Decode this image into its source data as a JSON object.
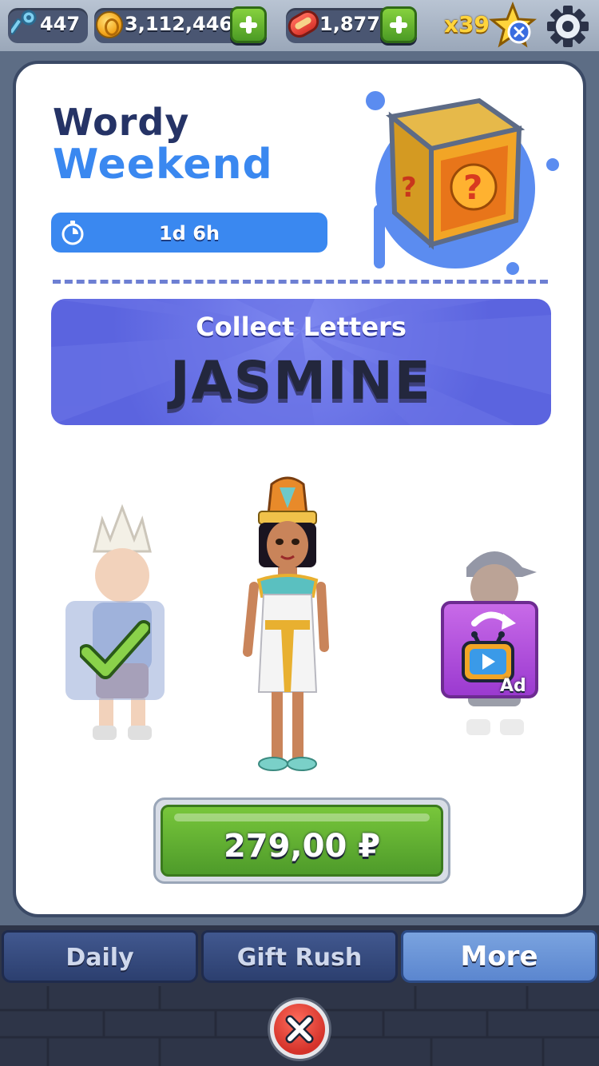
{
  "topbar": {
    "keys": "447",
    "coins": "3,112,446",
    "boards": "1,877",
    "multiplier": "x39"
  },
  "event": {
    "title_line1": "Wordy",
    "title_line2": "Weekend",
    "timer": "1d 6h"
  },
  "collect": {
    "label": "Collect Letters",
    "word": "JASMINE"
  },
  "purchase": {
    "price": "279,00 ₽"
  },
  "ad_badge": "Ad",
  "tabs": [
    {
      "label": "Daily",
      "active": false
    },
    {
      "label": "Gift Rush",
      "active": false
    },
    {
      "label": "More",
      "active": true
    }
  ],
  "colors": {
    "accent_blue": "#3a88f0",
    "title_navy": "#253366",
    "panel_purple": "#5b64df",
    "buy_green": "#4e9b2a",
    "close_red": "#d4322a"
  },
  "icons": [
    "key-icon",
    "coin-icon",
    "hoverboard-icon",
    "star-icon",
    "gear-icon",
    "timer-icon",
    "mystery-box-icon",
    "checkmark-icon",
    "tv-ad-icon",
    "close-icon"
  ]
}
